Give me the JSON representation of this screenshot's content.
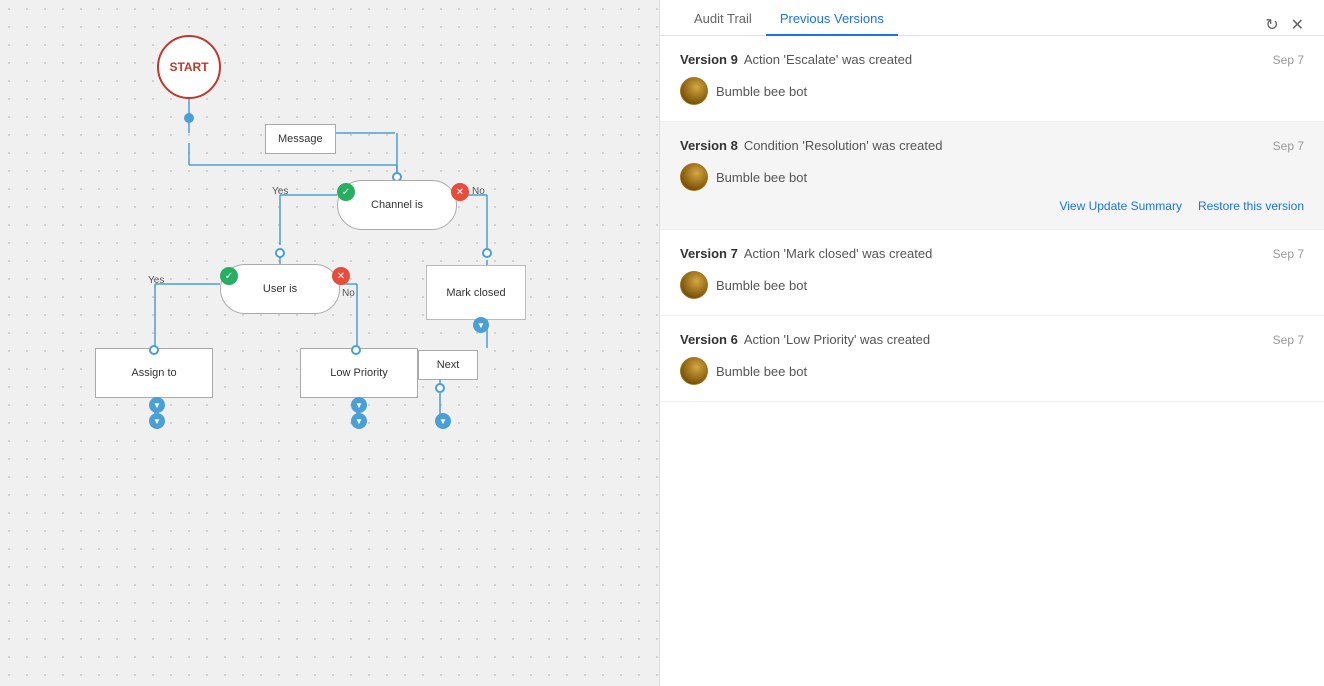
{
  "tabs": {
    "audit_trail": "Audit Trail",
    "previous_versions": "Previous Versions"
  },
  "active_tab": "previous_versions",
  "icons": {
    "refresh": "↻",
    "close": "✕",
    "check": "✓",
    "cross": "✕",
    "chevron_down": "❯"
  },
  "versions": [
    {
      "id": 9,
      "description": "Action 'Escalate' was created",
      "date": "Sep 7",
      "user": "Bumble bee bot",
      "highlighted": false,
      "show_actions": false
    },
    {
      "id": 8,
      "description": "Condition 'Resolution' was created",
      "date": "Sep 7",
      "user": "Bumble bee bot",
      "highlighted": true,
      "show_actions": true,
      "view_summary_label": "View Update Summary",
      "restore_label": "Restore this version"
    },
    {
      "id": 7,
      "description": "Action 'Mark closed' was created",
      "date": "Sep 7",
      "user": "Bumble bee bot",
      "highlighted": false,
      "show_actions": false
    },
    {
      "id": 6,
      "description": "Action 'Low Priority' was created",
      "date": "Sep 7",
      "user": "Bumble bee bot",
      "highlighted": false,
      "show_actions": false
    }
  ],
  "flow": {
    "start_label": "START",
    "message_label": "Message",
    "channel_label": "Channel is",
    "user_label": "User is",
    "assign_label": "Assign to",
    "low_priority_label": "Low Priority",
    "mark_closed_label": "Mark closed",
    "next_label": "Next",
    "yes_label_1": "Yes",
    "no_label_1": "No",
    "yes_label_2": "Yes",
    "no_label_2": "No"
  }
}
